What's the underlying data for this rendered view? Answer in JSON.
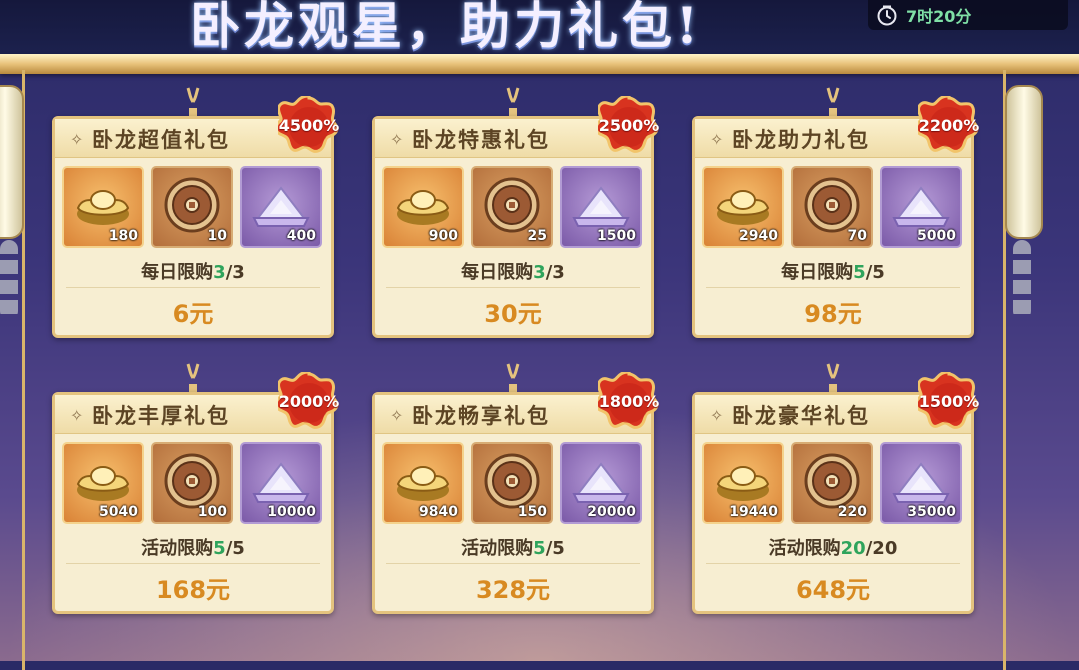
{
  "header": {
    "title": "卧龙观星，助力礼包!",
    "timer": "7时20分"
  },
  "colors": {
    "badge_red": "#d8331f",
    "price_orange": "#d88a21",
    "count_green": "#2fa45c"
  },
  "packs": [
    {
      "name": "卧龙超值礼包",
      "discount": "4500%",
      "items": [
        {
          "icon": "gold-ingot-icon",
          "qty": "180"
        },
        {
          "icon": "bronze-coin-icon",
          "qty": "10"
        },
        {
          "icon": "silver-powder-icon",
          "qty": "400"
        }
      ],
      "limit_label": "每日限购",
      "limit_used": "3",
      "limit_total": "/3",
      "price": "6元"
    },
    {
      "name": "卧龙特惠礼包",
      "discount": "2500%",
      "items": [
        {
          "icon": "gold-ingot-icon",
          "qty": "900"
        },
        {
          "icon": "bronze-coin-icon",
          "qty": "25"
        },
        {
          "icon": "silver-powder-icon",
          "qty": "1500"
        }
      ],
      "limit_label": "每日限购",
      "limit_used": "3",
      "limit_total": "/3",
      "price": "30元"
    },
    {
      "name": "卧龙助力礼包",
      "discount": "2200%",
      "items": [
        {
          "icon": "gold-ingot-icon",
          "qty": "2940"
        },
        {
          "icon": "bronze-coin-icon",
          "qty": "70"
        },
        {
          "icon": "silver-powder-icon",
          "qty": "5000"
        }
      ],
      "limit_label": "每日限购",
      "limit_used": "5",
      "limit_total": "/5",
      "price": "98元"
    },
    {
      "name": "卧龙丰厚礼包",
      "discount": "2000%",
      "items": [
        {
          "icon": "gold-ingot-icon",
          "qty": "5040"
        },
        {
          "icon": "bronze-coin-icon",
          "qty": "100"
        },
        {
          "icon": "silver-powder-icon",
          "qty": "10000"
        }
      ],
      "limit_label": "活动限购",
      "limit_used": "5",
      "limit_total": "/5",
      "price": "168元"
    },
    {
      "name": "卧龙畅享礼包",
      "discount": "1800%",
      "items": [
        {
          "icon": "gold-ingot-icon",
          "qty": "9840"
        },
        {
          "icon": "bronze-coin-icon",
          "qty": "150"
        },
        {
          "icon": "silver-powder-icon",
          "qty": "20000"
        }
      ],
      "limit_label": "活动限购",
      "limit_used": "5",
      "limit_total": "/5",
      "price": "328元"
    },
    {
      "name": "卧龙豪华礼包",
      "discount": "1500%",
      "items": [
        {
          "icon": "gold-ingot-icon",
          "qty": "19440"
        },
        {
          "icon": "bronze-coin-icon",
          "qty": "220"
        },
        {
          "icon": "silver-powder-icon",
          "qty": "35000"
        }
      ],
      "limit_label": "活动限购",
      "limit_used": "20",
      "limit_total": "/20",
      "price": "648元"
    }
  ]
}
